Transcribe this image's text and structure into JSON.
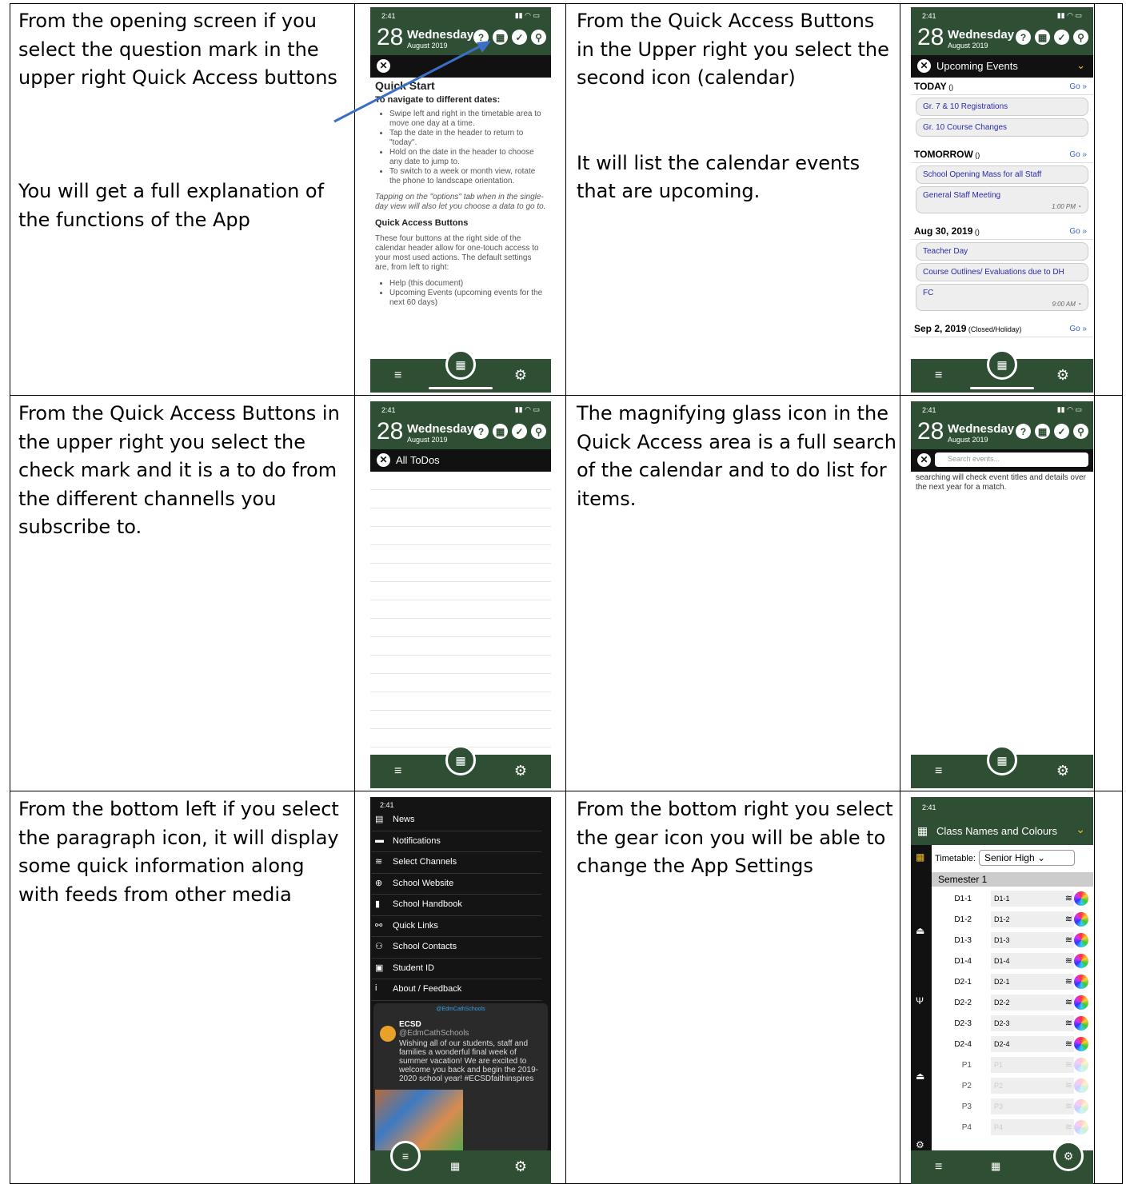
{
  "cells": {
    "c1": "From the opening screen if you select the question mark in the upper right Quick Access buttons\n\n\n\nYou will get a full explanation of the functions of the App",
    "c2": "From the Quick Access Buttons in the Upper right you select the second icon (calendar)\n\n\nIt will list the calendar events that are upcoming.",
    "c3": "From the Quick Access Buttons in the upper right you select the check mark and it is a to do from the different channells you subscribe to.",
    "c4": "The magnifying glass icon in the Quick Access area is a full search of the calendar and to do list for items.",
    "c5": "From the bottom left if you select the paragraph icon, it will display some quick information along with feeds from other media",
    "c6": "From the bottom right you select the gear icon you will be able to change the App Settings"
  },
  "phone": {
    "time": "2:41",
    "day_num": "28",
    "day_name": "Wednesday",
    "month": "August 2019"
  },
  "help": {
    "title": "Quick Start",
    "h1": "To navigate to different dates:",
    "bullets": [
      "Swipe left and right in the timetable area to move one day at a time.",
      "Tap the date in the header to return to \"today\".",
      "Hold on the date in the header to choose any date to jump to.",
      "To switch to a week or month view, rotate the phone to landscape orientation."
    ],
    "italic": "Tapping on the \"options\" tab when in the single-day view will also let you choose a data to go to.",
    "h2": "Quick Access Buttons",
    "para": "These four buttons at the right side of the calendar header allow for one-touch access to your most used actions. The default settings are, from left to right:",
    "bullets2": [
      "Help (this document)",
      "Upcoming Events (upcoming events for the next 60 days)"
    ]
  },
  "events": {
    "bar": "Upcoming Events",
    "go": "Go »",
    "groups": [
      {
        "head": "TODAY",
        "sub": " ()",
        "items": [
          {
            "t": "Gr. 7 & 10 Registrations",
            "tm": ""
          },
          {
            "t": "Gr. 10 Course Changes",
            "tm": ""
          }
        ]
      },
      {
        "head": "TOMORROW",
        "sub": " ()",
        "items": [
          {
            "t": "School Opening Mass for all Staff",
            "tm": ""
          },
          {
            "t": "General Staff Meeting",
            "tm": "1:00 PM"
          }
        ]
      },
      {
        "head": "Aug 30, 2019",
        "sub": " ()",
        "items": [
          {
            "t": "Teacher Day",
            "tm": ""
          },
          {
            "t": "Course Outlines/ Evaluations due to DH",
            "tm": ""
          },
          {
            "t": "FC",
            "tm": "9:00 AM"
          }
        ]
      },
      {
        "head": "Sep 2, 2019",
        "sub": " (Closed/Holiday)",
        "items": []
      }
    ]
  },
  "todos": {
    "bar": "All ToDos"
  },
  "search": {
    "placeholder": "Search events...",
    "note": "searching will check event titles and details over the next year for a match."
  },
  "menu": {
    "items": [
      "News",
      "Notifications",
      "Select Channels",
      "School Website",
      "School Handbook",
      "Quick Links",
      "School Contacts",
      "Student ID",
      "About / Feedback"
    ],
    "tweet_head": "@EdmCathSchools",
    "tweet_name": "ECSD",
    "tweet_handle": "@EdmCathSchools",
    "tweet_text": "Wishing all of our students, staff and families a wonderful final week of summer vacation! We are excited to welcome you back and begin the 2019-2020 school year! #ECSDfaithinspires"
  },
  "settings": {
    "title": "Class Names and Colours",
    "timetable_label": "Timetable:",
    "timetable_value": "Senior High",
    "semester": "Semester 1",
    "rows": [
      {
        "l": "D1-1",
        "v": "D1-1"
      },
      {
        "l": "D1-2",
        "v": "D1-2"
      },
      {
        "l": "D1-3",
        "v": "D1-3"
      },
      {
        "l": "D1-4",
        "v": "D1-4"
      },
      {
        "l": "D2-1",
        "v": "D2-1"
      },
      {
        "l": "D2-2",
        "v": "D2-2"
      },
      {
        "l": "D2-3",
        "v": "D2-3"
      },
      {
        "l": "D2-4",
        "v": "D2-4"
      },
      {
        "l": "P1",
        "v": "P1"
      },
      {
        "l": "P2",
        "v": "P2"
      },
      {
        "l": "P3",
        "v": "P3"
      },
      {
        "l": "P4",
        "v": "P4"
      }
    ]
  },
  "colors": {
    "app_green": "#2f4f34",
    "arrow": "#3b6fc4"
  }
}
